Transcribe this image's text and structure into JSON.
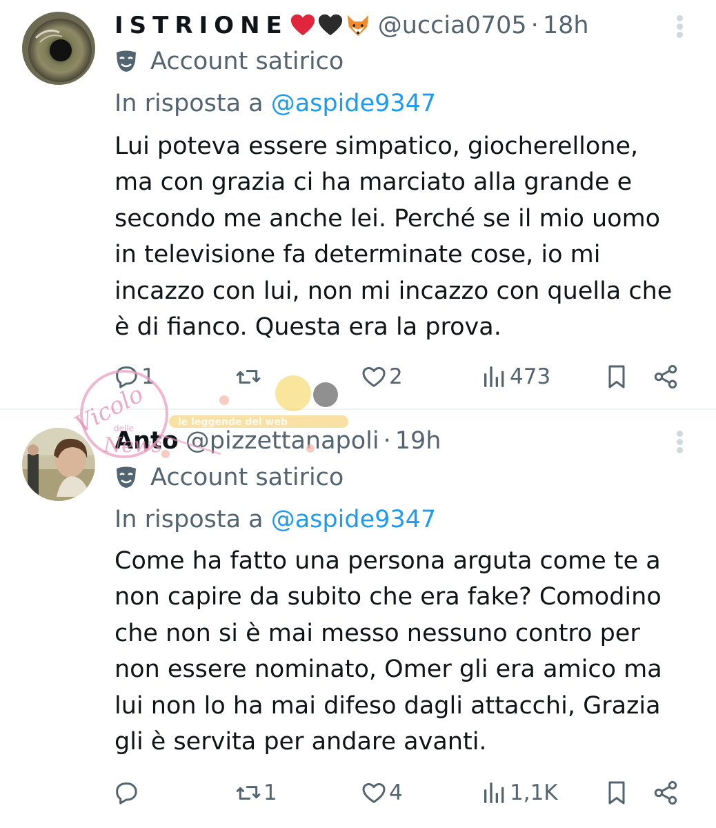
{
  "tweets": [
    {
      "display_name": "ISTRIONE",
      "handle": "@uccia0705",
      "separator": "·",
      "time": "18h",
      "label": "Account satirico",
      "reply_prefix": "In risposta a",
      "reply_to": "@aspide9347",
      "text_lines": [
        "Lui poteva essere simpatico, giocherellone,",
        "ma con grazia ci ha marciato alla grande e",
        "secondo me anche lei. Perché se il mio uomo",
        "in televisione fa determinate cose, io mi",
        "incazzo con lui, non mi incazzo con quella che",
        "è di fianco. Questa era la prova."
      ],
      "replies": "1",
      "retweets": "",
      "likes": "2",
      "views": "473"
    },
    {
      "display_name": "Anto",
      "handle": "@pizzettanapoli",
      "separator": "·",
      "time": "19h",
      "label": "Account satirico",
      "reply_prefix": "In risposta a",
      "reply_to": "@aspide9347",
      "text_lines": [
        "Come ha fatto una persona arguta come te a",
        "non capire da subito che era fake? Comodino",
        "che non si è mai messo nessuno contro per",
        "non essere nominato, Omer gli era amico ma",
        "lui non lo ha mai difeso dagli attacchi, Grazia",
        "gli è servita per andare avanti."
      ],
      "replies": "",
      "retweets": "1",
      "likes": "4",
      "views": "1,1K"
    }
  ],
  "icons": {
    "more": "more-vertical-icon",
    "label": "theater-mask-icon",
    "reply": "reply-icon",
    "retweet": "retweet-icon",
    "like": "heart-icon",
    "views": "views-icon",
    "bookmark": "bookmark-icon",
    "share": "share-icon"
  },
  "emojis": [
    "red-heart",
    "black-heart",
    "fox-face"
  ],
  "watermark": {
    "script_text": "Vicolo delle News",
    "banner_text": "le leggende del web"
  },
  "colors": {
    "text": "#0f1419",
    "secondary": "#536471",
    "link": "#1d9bf0",
    "divider": "#eff3f4",
    "watermark_pink": "#e8a0c0"
  }
}
